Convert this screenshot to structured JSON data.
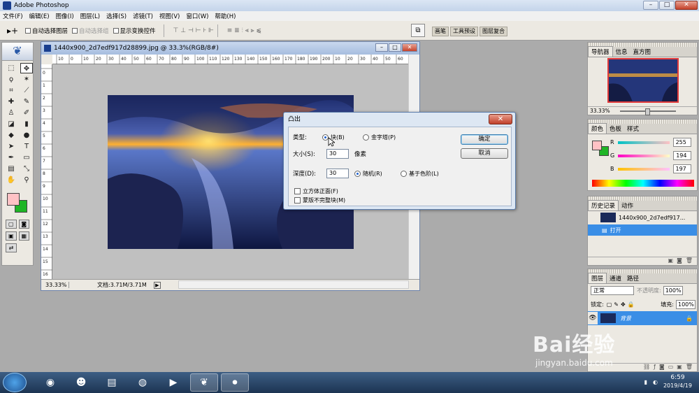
{
  "app": {
    "title": "Adobe Photoshop"
  },
  "window_controls": {
    "min": "–",
    "max": "□",
    "close": "✕"
  },
  "menu": [
    "文件(F)",
    "编辑(E)",
    "图像(I)",
    "图层(L)",
    "选择(S)",
    "滤镜(T)",
    "视图(V)",
    "窗口(W)",
    "帮助(H)"
  ],
  "options": {
    "tool_glyph": "▸+",
    "auto_select_layer": "自动选择图层",
    "auto_select_group": "自动选择组",
    "show_transform": "显示变换控件",
    "align_group1": "⊤ ⊥ ⊣ ⊢ ⊦ ⊩",
    "align_group2": "≡ ≣ ⫶ ⫷ ⫸ ⫹",
    "well_tabs": [
      "画笔",
      "工具预设",
      "图层复合"
    ]
  },
  "document": {
    "title": "1440x900_2d7edf917d28899.jpg @ 33.3%(RGB/8#)",
    "hruler_ticks": [
      "10",
      "0",
      "10",
      "20",
      "30",
      "40",
      "50",
      "60",
      "70",
      "80",
      "90",
      "100",
      "110",
      "120",
      "130",
      "140",
      "150",
      "160",
      "170",
      "180",
      "190",
      "200",
      "10",
      "20",
      "30",
      "40",
      "50",
      "60"
    ],
    "vruler_ticks": [
      "0",
      "1",
      "2",
      "3",
      "4",
      "5",
      "6",
      "7",
      "8",
      "9",
      "10",
      "11",
      "12",
      "13",
      "14",
      "15",
      "16"
    ],
    "zoom": "33.33%",
    "doc_size": "文档:3.71M/3.71M"
  },
  "dialog": {
    "title": "凸出",
    "close": "✕",
    "type_label": "类型:",
    "type_block": "块(B)",
    "type_pyramid": "金字塔(P)",
    "size_label": "大小(S):",
    "size_value": "30",
    "size_unit": "像素",
    "depth_label": "深度(D):",
    "depth_value": "30",
    "depth_random": "随机(R)",
    "depth_level": "基于色阶(L)",
    "solid_front": "立方体正面(F)",
    "mask_incomplete": "蒙版不完整块(M)",
    "ok": "确定",
    "cancel": "取消"
  },
  "navigator": {
    "tabs": [
      "导航器",
      "信息",
      "直方图"
    ],
    "zoom": "33.33%"
  },
  "color_panel": {
    "tabs": [
      "颜色",
      "色板",
      "样式"
    ],
    "r_label": "R",
    "r_value": "255",
    "g_label": "G",
    "g_value": "194",
    "b_label": "B",
    "b_value": "197",
    "foreground": "#ffc2c5",
    "background": "#1fb526"
  },
  "history": {
    "tabs": [
      "历史记录",
      "动作"
    ],
    "snapshot": "1440x900_2d7edf917...",
    "step": "打开"
  },
  "layers": {
    "tabs": [
      "图层",
      "通道",
      "路径"
    ],
    "blend": "正常",
    "opacity_label": "不透明度:",
    "opacity": "100%",
    "lock_label": "锁定:",
    "fill_label": "填充:",
    "fill": "100%",
    "layer_name": "背景"
  },
  "taskbar": {
    "time": "6:59",
    "date": "2019/4/19"
  },
  "watermark": {
    "brand": "Bai经验",
    "url": "jingyan.baidu.com"
  },
  "colors": {
    "accent": "#3a8ee6",
    "title_bar": "#c4d4ea"
  }
}
